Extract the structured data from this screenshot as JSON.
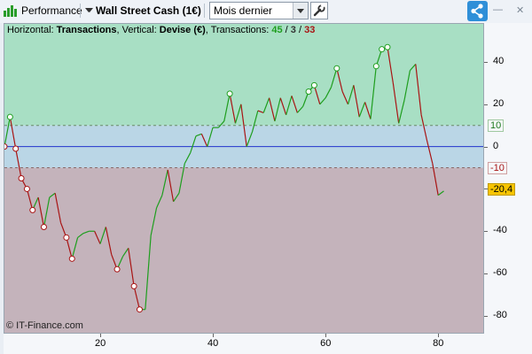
{
  "toolbar": {
    "performance_label": "Performance",
    "instrument_label": "Wall Street Cash (1€)",
    "period_value": "Mois dernier",
    "minimize_label": "—",
    "close_label": "✕"
  },
  "header": {
    "horizontal_prefix": "Horizontal: ",
    "horizontal_value": "Transactions",
    "vertical_prefix": ", Vertical: ",
    "vertical_value": "Devise (€)",
    "transactions_prefix": ", Transactions: ",
    "tx_wins": "45",
    "tx_sep1": " / ",
    "tx_neutral": "3",
    "tx_sep2": " / ",
    "tx_losses": "33"
  },
  "credit": "© IT-Finance.com",
  "colors": {
    "profit_zone": "#a8dfc4",
    "neutral_zone": "#bad6e6",
    "loss_zone": "#c4b3bb",
    "win_line": "#1e9e1e",
    "loss_line": "#a81414",
    "zero_line": "#2233cc"
  },
  "chart_data": {
    "type": "line",
    "xlim": [
      3,
      88
    ],
    "ylim": [
      -88,
      58
    ],
    "x_ticks": [
      20,
      40,
      60,
      80
    ],
    "y_ticks": [
      40,
      20,
      0,
      -20,
      -40,
      -60,
      -80
    ],
    "reference_lines": [
      10,
      -10
    ],
    "badges": {
      "upper": "10",
      "lower": "-10",
      "current": "-20,4"
    },
    "x": [
      3,
      4,
      5,
      6,
      7,
      8,
      9,
      10,
      11,
      12,
      13,
      14,
      15,
      16,
      17,
      18,
      19,
      20,
      21,
      22,
      23,
      24,
      25,
      26,
      27,
      28,
      29,
      30,
      31,
      32,
      33,
      34,
      35,
      36,
      37,
      38,
      39,
      40,
      41,
      42,
      43,
      44,
      45,
      46,
      47,
      48,
      49,
      50,
      51,
      52,
      53,
      54,
      55,
      56,
      57,
      58,
      59,
      60,
      61,
      62,
      63,
      64,
      65,
      66,
      67,
      68,
      69,
      70,
      71,
      72,
      73,
      74,
      75,
      76,
      77,
      78,
      79,
      80,
      81
    ],
    "y": [
      0,
      14,
      -1,
      -15,
      -20,
      -30,
      -24,
      -38,
      -24,
      -22,
      -36,
      -43,
      -53,
      -43,
      -41,
      -40,
      -40,
      -46,
      -38,
      -51,
      -58,
      -52,
      -48,
      -66,
      -77,
      -77,
      -42,
      -29,
      -23,
      -11,
      -26,
      -22,
      -8,
      -3,
      5,
      6,
      0,
      9,
      9,
      12,
      25,
      11,
      20,
      0,
      7,
      17,
      16,
      23,
      12,
      23,
      15,
      24,
      16,
      19,
      26,
      29,
      20,
      23,
      28,
      37,
      26,
      20,
      29,
      14,
      21,
      13,
      38,
      46,
      47,
      30,
      11,
      22,
      36,
      39,
      15,
      3,
      -8,
      -23,
      -21
    ]
  }
}
